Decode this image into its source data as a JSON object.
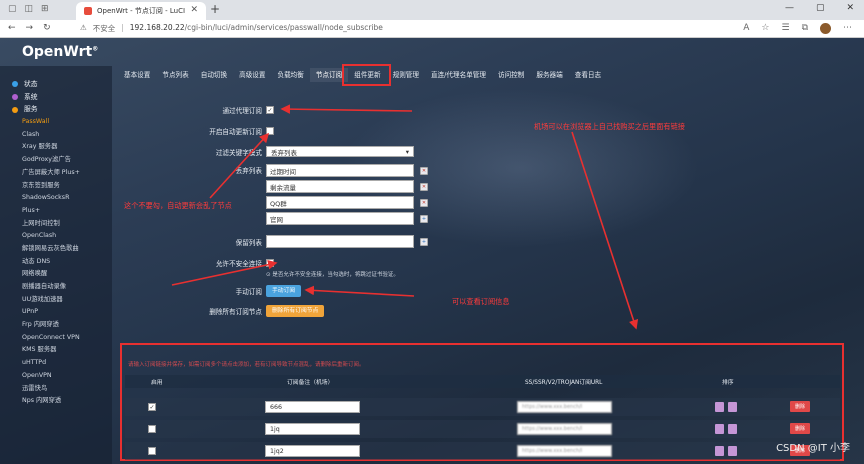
{
  "browser": {
    "tab_title": "OpenWrt - 节点订阅 - LuCI",
    "tab_close": "✕",
    "new_tab": "+",
    "insecure_label": "不安全",
    "url_host": "192.168.20.22",
    "url_path": "/cgi-bin/luci/admin/services/passwall/node_subscribe"
  },
  "brand": {
    "name": "OpenWrt",
    "mark": "®"
  },
  "sidebar": {
    "main_items": [
      {
        "label": "状态",
        "color": "#3aa0e8"
      },
      {
        "label": "系统",
        "color": "#b060d0"
      },
      {
        "label": "服务",
        "color": "#f39c12"
      }
    ],
    "items": [
      "PassWall",
      "Clash",
      "Xray 服务器",
      "GodProxy滤广告",
      "广告屏蔽大师 Plus+",
      "京东签到服务",
      "ShadowSocksR",
      "Plus+",
      "上网时间控制",
      "OpenClash",
      "解锁网易云灰色歌曲",
      "动态 DNS",
      "网络唤醒",
      "剧播器自动录像",
      "UU游戏加速器",
      "UPnP",
      "Frp 内网穿透",
      "OpenConnect VPN",
      "KMS 服务器",
      "uHTTPd",
      "OpenVPN",
      "迅雷快鸟",
      "Nps 内网穿透"
    ]
  },
  "topnav": [
    "基本设置",
    "节点列表",
    "自动切换",
    "高级设置",
    "负载均衡",
    "节点订阅",
    "组件更新",
    "规则管理",
    "直连/代理名单管理",
    "访问控制",
    "服务器端",
    "查看日志"
  ],
  "form": {
    "proxy_sub_label": "通过代理订阅",
    "auto_update_label": "开启自动更新订阅",
    "filter_mode_label": "过滤关键字模式",
    "filter_mode_value": "丢弃列表",
    "discard_list_label": "丢弃列表",
    "discard_items": [
      "过期时间",
      "剩余流量",
      "QQ群",
      "官网"
    ],
    "keep_list_label": "保留列表",
    "insecure_label": "允许不安全连接",
    "insecure_hint": "⊙ 是否允许不安全连接，当勾选时，将跳过证书验证。",
    "manual_sub_label": "手动订阅",
    "manual_sub_button": "手动订阅",
    "delete_all_label": "删除所有订阅节点",
    "delete_all_button": "删除所有订阅节点"
  },
  "annotations": {
    "right_top": "机场可以在浏览器上自己找购买之后里面有链接",
    "left_mid": "这个不要勾，自动更新会乱了节点",
    "manual": "可以查看订阅信息"
  },
  "table": {
    "note": "请输入订阅链接并保存，如需订阅多个请点击添加，若有订阅导致节点混乱，请删除后重新订阅。",
    "headers": [
      "启用",
      "订阅备注（机场）",
      "SS/SSR/V2/TROJAN订阅URL",
      "排序"
    ],
    "rows": [
      {
        "enabled": "✓",
        "name": "666",
        "url": "https://www.xxx.bench/l",
        "del": "删除"
      },
      {
        "enabled": "",
        "name": "1jq",
        "url": "https://www.xxx.bench/l",
        "del": "删除"
      },
      {
        "enabled": "",
        "name": "1jq2",
        "url": "https://www.xxx.bench/l",
        "del": "删除"
      }
    ]
  },
  "watermark": "CSDN @IT 小李"
}
